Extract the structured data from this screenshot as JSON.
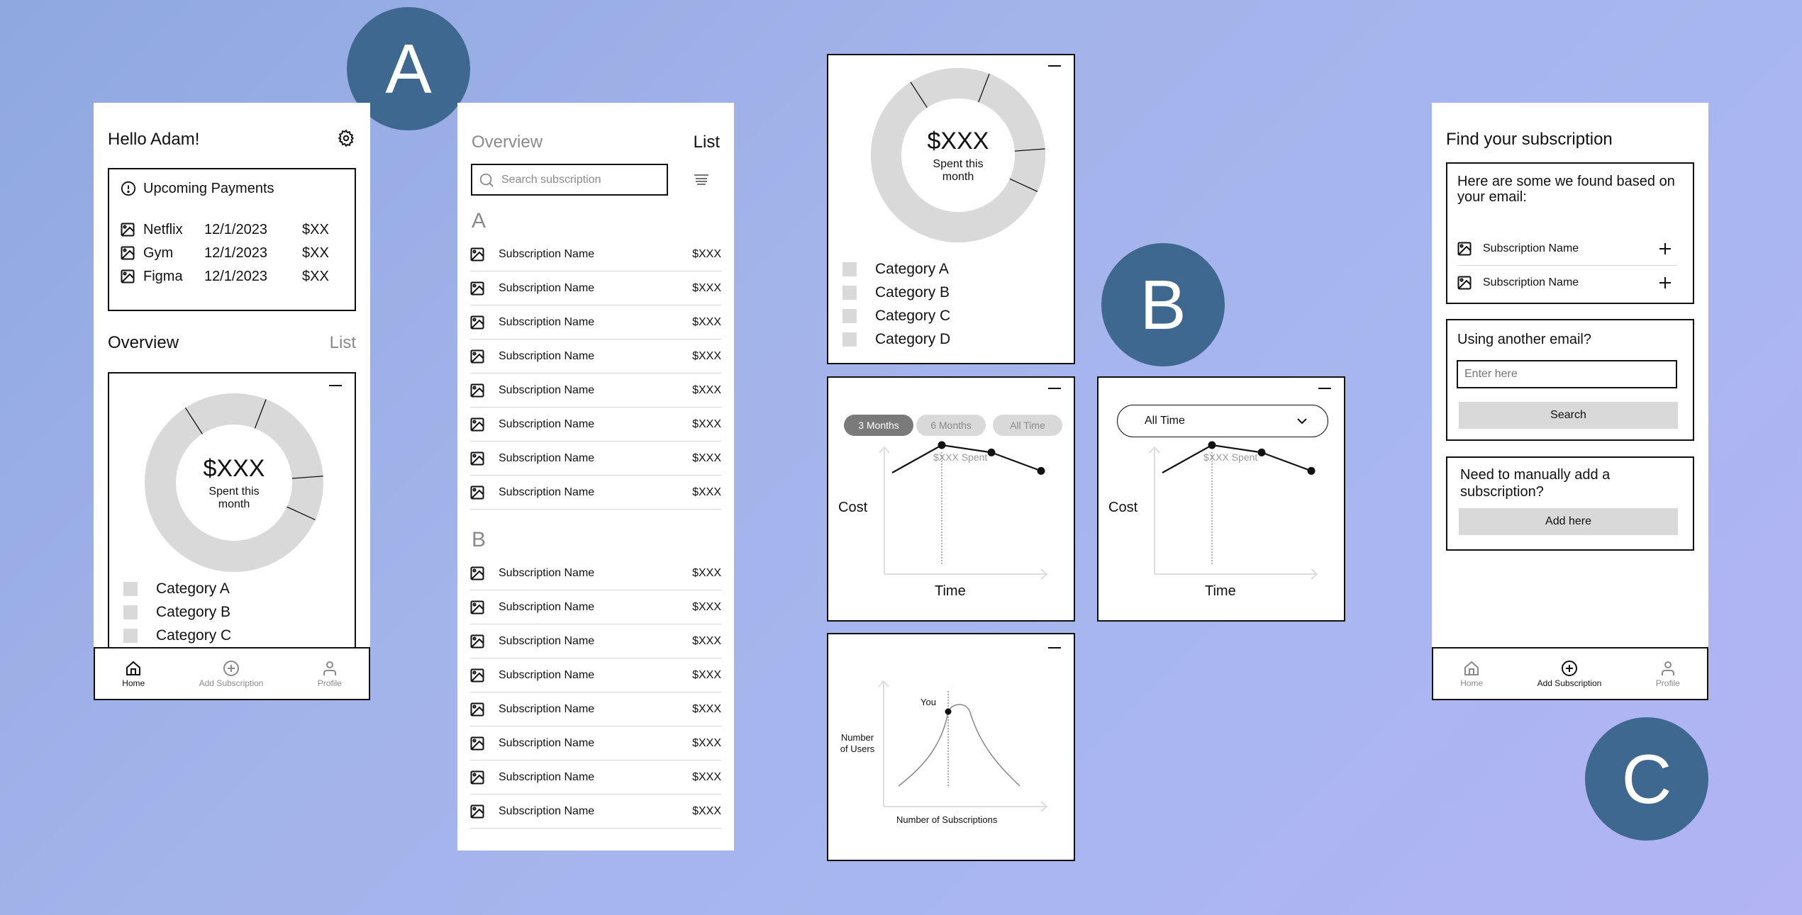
{
  "badges": {
    "a": "A",
    "b": "B",
    "c": "C"
  },
  "colors": {
    "badge": "#3e6890",
    "panel": "#ffffff",
    "donut": "#d9d9d9",
    "pill_active": "#7a7a7a",
    "pill_inactive": "#d9d9d9"
  },
  "home": {
    "greeting": "Hello Adam!",
    "settings_icon": "gear-icon",
    "upcoming": {
      "title": "Upcoming Payments",
      "icon": "alert-circle-icon",
      "items": [
        {
          "name": "Netflix",
          "date": "12/1/2023",
          "amount": "$XX"
        },
        {
          "name": "Gym",
          "date": "12/1/2023",
          "amount": "$XX"
        },
        {
          "name": "Figma",
          "date": "12/1/2023",
          "amount": "$XX"
        }
      ]
    },
    "tabs": {
      "overview": "Overview",
      "list": "List"
    },
    "donut": {
      "amount": "$XXX",
      "caption_line1": "Spent this",
      "caption_line2": "month",
      "legend": [
        "Category A",
        "Category B",
        "Category C"
      ]
    },
    "nav": [
      {
        "label": "Home",
        "icon": "home-icon",
        "active": true
      },
      {
        "label": "Add Subscription",
        "icon": "plus-circle-icon",
        "active": false
      },
      {
        "label": "Profile",
        "icon": "user-icon",
        "active": false
      }
    ]
  },
  "list_screen": {
    "tabs": {
      "overview": "Overview",
      "list": "List"
    },
    "search_placeholder": "Search subscription",
    "filter_icon": "filter-lines-icon",
    "sections": [
      {
        "letter": "A",
        "items": [
          {
            "name": "Subscription Name",
            "amount": "$XXX"
          },
          {
            "name": "Subscription Name",
            "amount": "$XXX"
          },
          {
            "name": "Subscription Name",
            "amount": "$XXX"
          },
          {
            "name": "Subscription Name",
            "amount": "$XXX"
          },
          {
            "name": "Subscription Name",
            "amount": "$XXX"
          },
          {
            "name": "Subscription Name",
            "amount": "$XXX"
          },
          {
            "name": "Subscription Name",
            "amount": "$XXX"
          },
          {
            "name": "Subscription Name",
            "amount": "$XXX"
          }
        ]
      },
      {
        "letter": "B",
        "items": [
          {
            "name": "Subscription Name",
            "amount": "$XXX"
          },
          {
            "name": "Subscription Name",
            "amount": "$XXX"
          },
          {
            "name": "Subscription Name",
            "amount": "$XXX"
          },
          {
            "name": "Subscription Name",
            "amount": "$XXX"
          },
          {
            "name": "Subscription Name",
            "amount": "$XXX"
          },
          {
            "name": "Subscription Name",
            "amount": "$XXX"
          },
          {
            "name": "Subscription Name",
            "amount": "$XXX"
          },
          {
            "name": "Subscription Name",
            "amount": "$XXX"
          }
        ]
      }
    ]
  },
  "widgets": {
    "donut": {
      "amount": "$XXX",
      "caption_line1": "Spent this",
      "caption_line2": "month",
      "legend": [
        "Category A",
        "Category B",
        "Category C",
        "Category D"
      ]
    },
    "cost_pills": {
      "options": [
        "3 Months",
        "6 Months",
        "All Time"
      ],
      "selected": "3 Months",
      "annotation": "$XXX Spent",
      "ylabel": "Cost",
      "xlabel": "Time"
    },
    "cost_dropdown": {
      "selected": "All Time",
      "annotation": "$XXX Spent",
      "ylabel": "Cost",
      "xlabel": "Time"
    },
    "distribution": {
      "marker_label": "You",
      "ylabel_line1": "Number",
      "ylabel_line2": "of Users",
      "xlabel": "Number of Subscriptions"
    }
  },
  "find": {
    "title": "Find your subscription",
    "found_intro": "Here are some we found based on your email:",
    "found_items": [
      {
        "name": "Subscription Name"
      },
      {
        "name": "Subscription Name"
      }
    ],
    "other_email_title": "Using another email?",
    "email_placeholder": "Enter here",
    "search_button": "Search",
    "manual_title": "Need to manually add a subscription?",
    "manual_button": "Add here",
    "nav": [
      {
        "label": "Home",
        "icon": "home-icon",
        "active": false
      },
      {
        "label": "Add Subscription",
        "icon": "plus-circle-icon",
        "active": true
      },
      {
        "label": "Profile",
        "icon": "user-icon",
        "active": false
      }
    ]
  },
  "chart_data": [
    {
      "type": "pie",
      "title": "$XXX Spent this month",
      "categories": [
        "Category A",
        "Category B",
        "Category C",
        "Category D"
      ],
      "values": [
        15,
        18,
        8,
        59
      ],
      "donut": true
    },
    {
      "type": "line",
      "title": "",
      "xlabel": "Time",
      "ylabel": "Cost",
      "x": [
        0,
        1,
        2,
        3
      ],
      "values": [
        55,
        70,
        66,
        56
      ],
      "markers": [
        1,
        2,
        3
      ],
      "annotation": {
        "x": 1,
        "text": "$XXX Spent"
      },
      "grid": false
    },
    {
      "type": "line",
      "title": "",
      "xlabel": "Number of Subscriptions",
      "ylabel": "Number of Users",
      "x": [
        0,
        1,
        2,
        3,
        4,
        5,
        6
      ],
      "values": [
        5,
        30,
        80,
        85,
        55,
        20,
        5
      ],
      "annotation": {
        "x": 2,
        "text": "You"
      },
      "grid": false
    }
  ]
}
